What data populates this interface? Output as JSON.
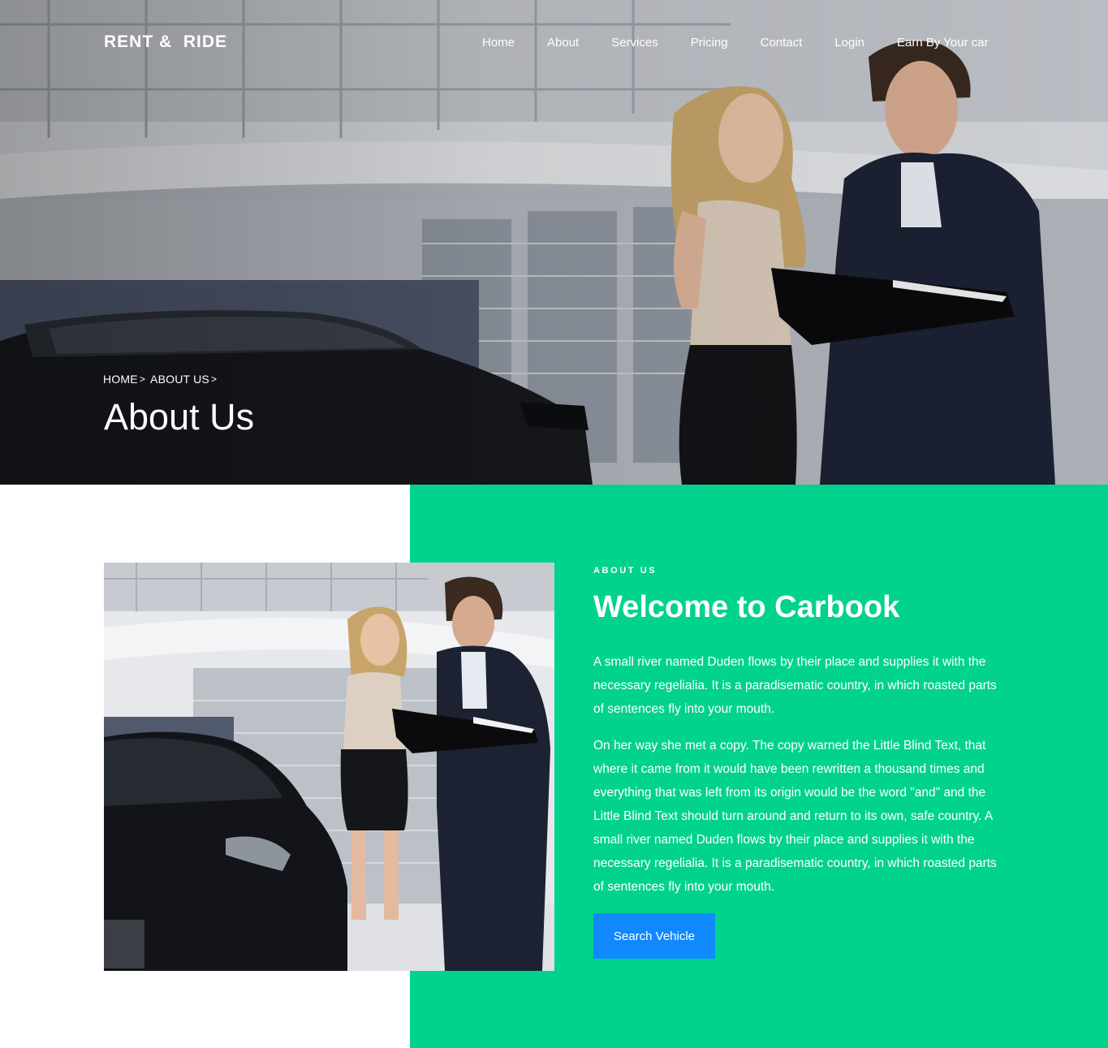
{
  "brand": {
    "name": "RENT &  RIDE"
  },
  "nav": {
    "items": [
      "Home",
      "About",
      "Services",
      "Pricing",
      "Contact",
      "Login",
      "Earn By Your car"
    ]
  },
  "hero": {
    "breadcrumb": [
      "HOME",
      "ABOUT US"
    ],
    "breadcrumb_separator": ">",
    "title": "About Us"
  },
  "about": {
    "eyebrow": "ABOUT US",
    "heading": "Welcome to Carbook",
    "paragraphs": [
      "A small river named Duden flows by their place and supplies it with the necessary regelialia. It is a paradisematic country, in which roasted parts of sentences fly into your mouth.",
      "On her way she met a copy. The copy warned the Little Blind Text, that where it came from it would have been rewritten a thousand times and everything that was left from its origin would be the word \"and\" and the Little Blind Text should turn around and return to its own, safe country. A small river named Duden flows by their place and supplies it with the necessary regelialia. It is a paradisematic country, in which roasted parts of sentences fly into your mouth."
    ],
    "button_label": "Search Vehicle"
  },
  "colors": {
    "accent_green": "#01d28e",
    "button_blue": "#1089ff",
    "text_white": "#ffffff"
  }
}
